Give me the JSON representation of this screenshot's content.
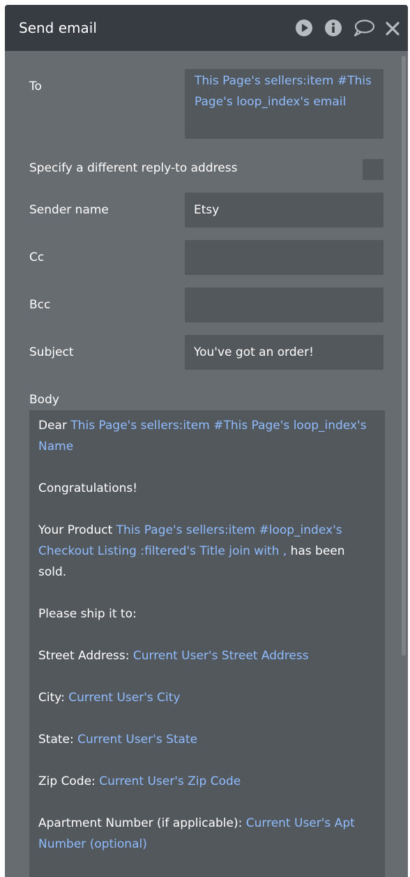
{
  "header": {
    "title": "Send email",
    "icons": [
      "play-icon",
      "info-icon",
      "comment-icon",
      "close-icon"
    ]
  },
  "form": {
    "to_label": "To",
    "to_value": "This Page's sellers:item #This Page's loop_index's email",
    "reply_to_label": "Specify a different reply-to address",
    "reply_to_checked": false,
    "sender_name_label": "Sender name",
    "sender_name_value": "Etsy",
    "cc_label": "Cc",
    "cc_value": "",
    "bcc_label": "Bcc",
    "bcc_value": "",
    "subject_label": "Subject",
    "subject_value": "You've got an order!",
    "body_label": "Body"
  },
  "body": {
    "dear_text": "Dear ",
    "dear_dyn": "This Page's sellers:item #This Page's loop_index's Name",
    "congrats": "Congratulations!",
    "product_text": "Your Product ",
    "product_dyn": "This Page's sellers:item #loop_index's Checkout Listing :filtered's Title join with ,",
    "product_tail": " has been sold.",
    "ship_to": "Please ship it to:",
    "street_label": "Street Address: ",
    "street_dyn": "Current User's Street Address",
    "city_label": "City: ",
    "city_dyn": "Current User's City",
    "state_label": "State: ",
    "state_dyn": "Current User's State",
    "zip_label": "Zip Code: ",
    "zip_dyn": "Current User's Zip Code",
    "apt_label": "Apartment Number (if applicable): ",
    "apt_dyn": "Current User's Apt Number (optional)"
  },
  "colors": {
    "panel_bg": "#676c71",
    "header_bg": "#373c42",
    "field_bg": "#53585d",
    "dynamic_text": "#8fbcff"
  }
}
